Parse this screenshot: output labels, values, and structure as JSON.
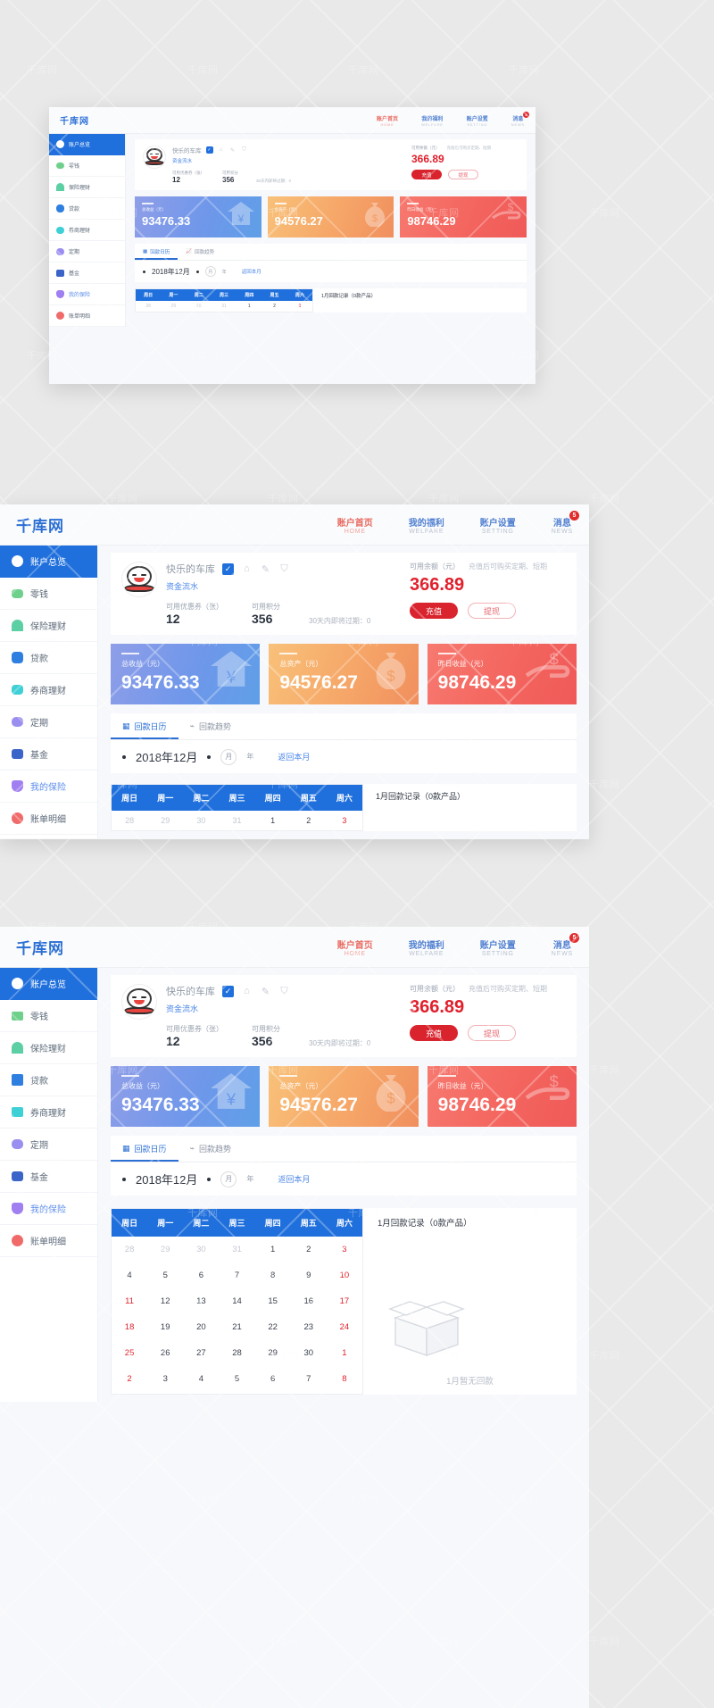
{
  "brand": {
    "logo": "千库网"
  },
  "nav": [
    {
      "cn": "账户首页",
      "en": "HOME",
      "active": true,
      "badge": ""
    },
    {
      "cn": "我的福利",
      "en": "WELFARE",
      "active": false,
      "badge": ""
    },
    {
      "cn": "账户设置",
      "en": "SETTING",
      "active": false,
      "badge": ""
    },
    {
      "cn": "消息",
      "en": "NEWS",
      "active": false,
      "badge": "5"
    }
  ],
  "sidebar": {
    "items": [
      {
        "label": "账户总览",
        "icon": "user-icon",
        "color": "#ffffff",
        "active": true
      },
      {
        "label": "零钱",
        "icon": "wallet-icon",
        "color": "#6fd08c",
        "active": false
      },
      {
        "label": "保险理财",
        "icon": "umbrella-icon",
        "color": "#5ccfa4",
        "active": false
      },
      {
        "label": "贷款",
        "icon": "house-icon",
        "color": "#2f7fe0",
        "active": false
      },
      {
        "label": "券商理财",
        "icon": "ticket-icon",
        "color": "#3fd0d6",
        "active": false
      },
      {
        "label": "定期",
        "icon": "piggy-icon",
        "color": "#9a8ef0",
        "active": false
      },
      {
        "label": "基金",
        "icon": "group-icon",
        "color": "#3a64c8",
        "active": false
      },
      {
        "label": "我的保险",
        "icon": "shield-icon",
        "color": "#a07ff0",
        "active": false
      },
      {
        "label": "账单明细",
        "icon": "bill-icon",
        "color": "#f06a6a",
        "active": false
      }
    ]
  },
  "profile": {
    "username": "快乐的车库",
    "flow_link": "资金流水",
    "action_icons": [
      "check-badge-icon",
      "user-outline-icon",
      "edit-icon",
      "shield-outline-icon"
    ],
    "stats": [
      {
        "label": "可用优惠券（张）",
        "value": "12"
      },
      {
        "label": "可用积分",
        "value": "356"
      }
    ],
    "expire_hint": "30天内即将过期：0"
  },
  "balance": {
    "label": "可用余额（元）",
    "hint": "充值后可购买定期、短期",
    "value": "366.89",
    "recharge_label": "充值",
    "withdraw_label": "提现",
    "accent": "#e0202c"
  },
  "stat_cards": [
    {
      "title": "总收益（元）",
      "value": "93476.33",
      "icon": "house-yen-icon",
      "color": "#6f97ea"
    },
    {
      "title": "总资产（元）",
      "value": "94576.27",
      "icon": "money-bag-icon",
      "color": "#f4a368"
    },
    {
      "title": "昨日收益（元）",
      "value": "98746.29",
      "icon": "hand-dollar-icon",
      "color": "#f4655f"
    }
  ],
  "tabs": [
    {
      "label": "回款日历",
      "icon": "calendar-icon",
      "active": true
    },
    {
      "label": "回款趋势",
      "icon": "chart-icon",
      "active": false
    }
  ],
  "date_bar": {
    "prev_icon": "prev-arrow",
    "date": "2018年12月",
    "next_icon": "next-arrow",
    "unit_month": "月",
    "unit_year": "年",
    "back_label": "返回本月"
  },
  "calendar": {
    "weekdays": [
      "周日",
      "周一",
      "周二",
      "周三",
      "周四",
      "周五",
      "周六"
    ],
    "weeks": [
      [
        {
          "d": "28",
          "s": "mute"
        },
        {
          "d": "29",
          "s": "mute"
        },
        {
          "d": "30",
          "s": "mute"
        },
        {
          "d": "31",
          "s": "mute"
        },
        {
          "d": "1",
          "s": ""
        },
        {
          "d": "2",
          "s": ""
        },
        {
          "d": "3",
          "s": "red"
        }
      ],
      [
        {
          "d": "4",
          "s": ""
        },
        {
          "d": "5",
          "s": ""
        },
        {
          "d": "6",
          "s": ""
        },
        {
          "d": "7",
          "s": ""
        },
        {
          "d": "8",
          "s": ""
        },
        {
          "d": "9",
          "s": ""
        },
        {
          "d": "10",
          "s": "red"
        }
      ],
      [
        {
          "d": "11",
          "s": "red"
        },
        {
          "d": "12",
          "s": ""
        },
        {
          "d": "13",
          "s": ""
        },
        {
          "d": "14",
          "s": ""
        },
        {
          "d": "15",
          "s": ""
        },
        {
          "d": "16",
          "s": ""
        },
        {
          "d": "17",
          "s": "red"
        }
      ],
      [
        {
          "d": "18",
          "s": "red"
        },
        {
          "d": "19",
          "s": ""
        },
        {
          "d": "20",
          "s": ""
        },
        {
          "d": "21",
          "s": ""
        },
        {
          "d": "22",
          "s": ""
        },
        {
          "d": "23",
          "s": ""
        },
        {
          "d": "24",
          "s": "red"
        }
      ],
      [
        {
          "d": "25",
          "s": "red"
        },
        {
          "d": "26",
          "s": ""
        },
        {
          "d": "27",
          "s": ""
        },
        {
          "d": "28",
          "s": ""
        },
        {
          "d": "29",
          "s": ""
        },
        {
          "d": "30",
          "s": ""
        },
        {
          "d": "1",
          "s": "red"
        }
      ],
      [
        {
          "d": "2",
          "s": "red"
        },
        {
          "d": "3",
          "s": ""
        },
        {
          "d": "4",
          "s": ""
        },
        {
          "d": "5",
          "s": ""
        },
        {
          "d": "6",
          "s": ""
        },
        {
          "d": "7",
          "s": ""
        },
        {
          "d": "8",
          "s": "red"
        }
      ]
    ]
  },
  "record_pane": {
    "title": "1月回款记录（0款产品）",
    "empty_text": "1月暂无回款",
    "empty_icon": "empty-box-icon"
  },
  "watermark": {
    "text": "千库网"
  }
}
